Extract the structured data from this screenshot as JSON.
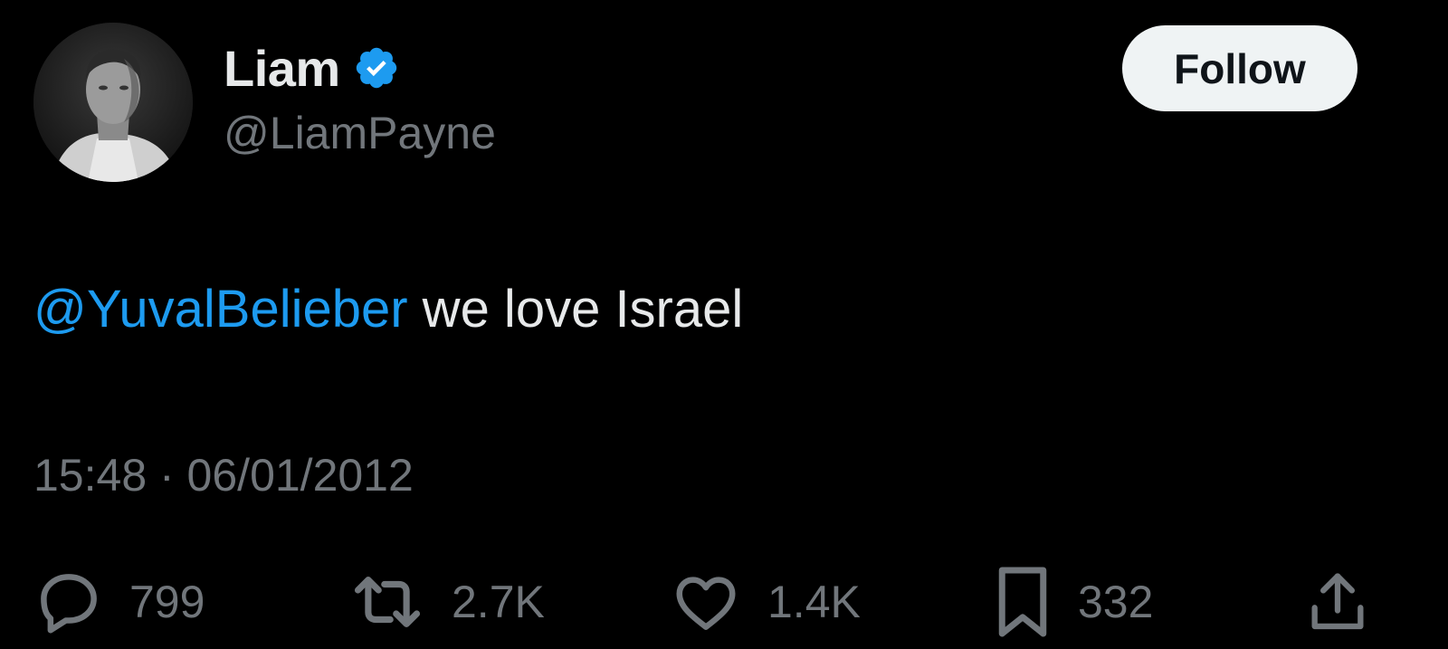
{
  "author": {
    "display_name": "Liam",
    "handle": "@LiamPayne",
    "verified": true,
    "avatar": "profile-photo"
  },
  "follow_button": {
    "label": "Follow"
  },
  "tweet": {
    "mention": "@YuvalBelieber",
    "text": " we love Israel",
    "timestamp": "15:48 · 06/01/2012"
  },
  "actions": {
    "replies": "799",
    "retweets": "2.7K",
    "likes": "1.4K",
    "bookmarks": "332"
  },
  "icons": {
    "reply": "speech-bubble-icon",
    "retweet": "retweet-arrows-icon",
    "like": "heart-icon",
    "bookmark": "bookmark-icon",
    "share": "share-upload-icon",
    "verified": "verified-badge-icon"
  },
  "colors": {
    "background": "#000000",
    "primary_text": "#e7e9ea",
    "secondary_text": "#71767b",
    "link": "#1d9bf0",
    "verified_badge": "#1d9bf0",
    "button_bg": "#eff3f4"
  }
}
